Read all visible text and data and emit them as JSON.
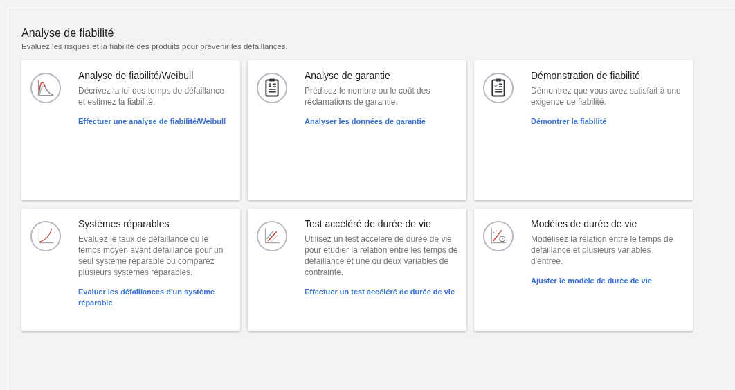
{
  "header": {
    "title": "Analyse de fiabilité",
    "subtitle": "Evaluez les risques et la fiabilité des produits pour prévenir les défaillances."
  },
  "cards": [
    {
      "kind": "weibull",
      "title": "Analyse de fiabilité/Weibull",
      "description": "Décrivez la loi des temps de défaillance et estimez la fiabilité.",
      "link": "Effectuer une analyse de fiabilité/Weibull"
    },
    {
      "kind": "warranty",
      "title": "Analyse de garantie",
      "description": "Prédisez le nombre ou le coût des réclamations de garantie.",
      "link": "Analyser les données de garantie"
    },
    {
      "kind": "demonstration",
      "title": "Démonstration de fiabilité",
      "description": "Démontrez que vous avez satisfait à une exigence de fiabilité.",
      "link": "Démontrer la fiabilité"
    },
    {
      "kind": "repairable",
      "title": "Systèmes réparables",
      "description": "Evaluez le taux de défaillance ou le temps moyen avant défaillance pour un seul système réparable ou comparez plusieurs systèmes réparables.",
      "link": "Evaluer les défaillances d'un système réparable"
    },
    {
      "kind": "accelerated",
      "title": "Test accéléré de durée de vie",
      "description": "Utilisez un test accéléré de durée de vie pour étudier la relation entre les temps de défaillance et une ou deux variables de contrainte.",
      "link": "Effectuer un test accéléré de durée de vie"
    },
    {
      "kind": "lifemodel",
      "title": "Modèles de durée de vie",
      "description": "Modélisez la relation entre le temps de défaillance et plusieurs variables d'entrée.",
      "link": "Ajuster le modèle de durée de vie"
    }
  ]
}
